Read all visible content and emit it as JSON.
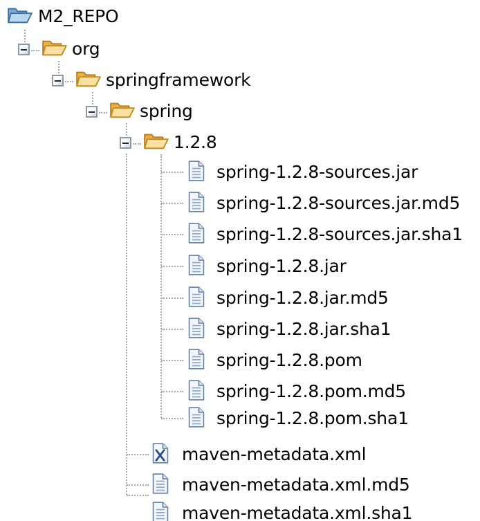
{
  "tree": {
    "root": {
      "label": "M2_REPO",
      "icon": "folder-open-icon"
    },
    "org": {
      "label": "org",
      "icon": "folder-open-icon",
      "expanded": true
    },
    "springframework": {
      "label": "springframework",
      "icon": "folder-open-icon",
      "expanded": true
    },
    "spring": {
      "label": "spring",
      "icon": "folder-open-icon",
      "expanded": true
    },
    "version": {
      "label": "1.2.8",
      "icon": "folder-open-icon",
      "expanded": true
    },
    "version_files": [
      {
        "label": "spring-1.2.8-sources.jar",
        "icon": "file-icon"
      },
      {
        "label": "spring-1.2.8-sources.jar.md5",
        "icon": "file-icon"
      },
      {
        "label": "spring-1.2.8-sources.jar.sha1",
        "icon": "file-icon"
      },
      {
        "label": "spring-1.2.8.jar",
        "icon": "file-icon"
      },
      {
        "label": "spring-1.2.8.jar.md5",
        "icon": "file-icon"
      },
      {
        "label": "spring-1.2.8.jar.sha1",
        "icon": "file-icon"
      },
      {
        "label": "spring-1.2.8.pom",
        "icon": "file-icon"
      },
      {
        "label": "spring-1.2.8.pom.md5",
        "icon": "file-icon"
      },
      {
        "label": "spring-1.2.8.pom.sha1",
        "icon": "file-icon"
      }
    ],
    "spring_files": [
      {
        "label": "maven-metadata.xml",
        "icon": "xml-file-icon"
      },
      {
        "label": "maven-metadata.xml.md5",
        "icon": "file-icon"
      },
      {
        "label": "maven-metadata.xml.sha1",
        "icon": "file-icon"
      }
    ]
  },
  "colors": {
    "folder_fill": "#f7d27e",
    "folder_outline": "#c08a1e",
    "root_folder_fill": "#9cc3ea",
    "root_folder_outline": "#3f6f9f",
    "file_fill": "#e8eff8",
    "file_outline": "#6d87a8",
    "guide": "#a8a8a8"
  }
}
